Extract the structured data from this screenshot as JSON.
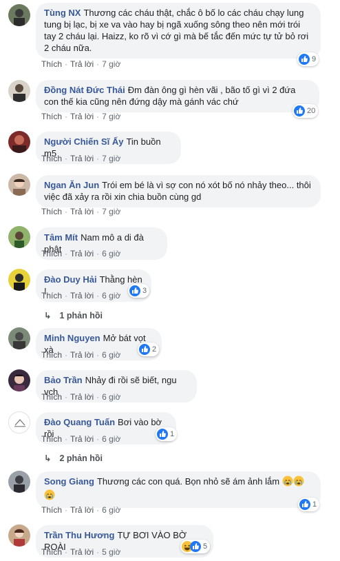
{
  "actions": {
    "like": "Thích",
    "reply": "Trả lời"
  },
  "comments": [
    {
      "name": "Tùng NX",
      "text": "Thương các cháu thật, chắc ô bố lo các cháu chạy lung tung bị lạc, bị xe va vào hay bị ngã xuống sông theo nên mới trói tay 2 cháu lại. Haizz, ko rõ vì cớ gì mà bế tắc đến mức tự tử bỏ rơi 2 cháu nữa.",
      "time": "7 giờ",
      "reactions": "9"
    },
    {
      "name": "Đồng Nát Đức Thái",
      "text": "Đm đàn ông gì hèn vãi , bão tố gì vì 2 đứa con thế kia cũng nên đứng dậy mà gánh vác chứ",
      "time": "7 giờ",
      "reactions": "20"
    },
    {
      "name": "Người Chiến Sĩ Ấy",
      "text": "Tin buồn m5",
      "time": "7 giờ"
    },
    {
      "name": "Ngan Ăn Jun",
      "text": "Trói em bé là vì sợ con nó xót bố nó nhảy theo... thôi việc đã xảy ra rồi xin chia buồn cùng gd",
      "time": "7 giờ"
    },
    {
      "name": "Tâm Mít",
      "text": "Nam mô a di đà phật",
      "time": "6 giờ"
    },
    {
      "name": "Đào Duy Hải",
      "text": "Thằng hèn !",
      "time": "6 giờ",
      "reactions": "3",
      "replies": "1 phản hồi"
    },
    {
      "name": "Minh Nguyen",
      "text": "Mở bát vọt xà",
      "time": "6 giờ",
      "reactions": "2"
    },
    {
      "name": "Bảo Trần",
      "text": "Nhảy đi rồi sẽ biết, ngu vch",
      "time": "6 giờ"
    },
    {
      "name": "Đào Quang Tuấn",
      "text": "Bơi vào bờ rồi",
      "time": "6 giờ",
      "reactions": "1",
      "replies": "2 phản hồi"
    },
    {
      "name": "Song Giang",
      "text": "Thương các con quá. Bọn nhỏ sẽ ám ảnh lắm",
      "time": "6 giờ",
      "reactions": "1"
    },
    {
      "name": "Trần Thu Hương",
      "text": "TỰ BƠI VÀO BỜ ROÀI",
      "time": "5 giờ",
      "reactions": "5"
    }
  ],
  "colors": {
    "name": "#385898",
    "bubble": "#f2f3f5",
    "like": "#2078f4",
    "meta": "#616770"
  },
  "icons": [
    "like-icon",
    "haha-icon",
    "cry-icon",
    "reply-arrow-icon"
  ]
}
